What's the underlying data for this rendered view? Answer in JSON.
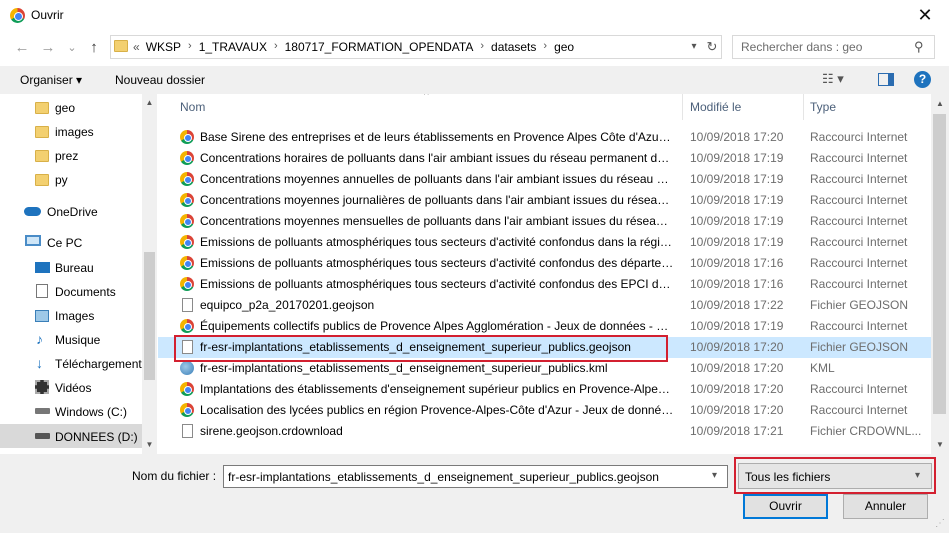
{
  "window": {
    "title": "Ouvrir",
    "close_glyph": "✕"
  },
  "nav": {
    "back_glyph": "←",
    "forward_glyph": "→",
    "recent_glyph": "⌄",
    "up_glyph": "↑",
    "breadcrumb_prefix": "«",
    "breadcrumbs": [
      "WKSP",
      "1_TRAVAUX",
      "180717_FORMATION_OPENDATA",
      "datasets",
      "geo"
    ],
    "search_placeholder": "Rechercher dans : geo"
  },
  "toolbar": {
    "organize_label": "Organiser ▾",
    "new_folder_label": "Nouveau dossier",
    "help_glyph": "?"
  },
  "sidebar": {
    "items": [
      {
        "label": "geo",
        "icon": "folder-icon"
      },
      {
        "label": "images",
        "icon": "folder-icon"
      },
      {
        "label": "prez",
        "icon": "folder-icon"
      },
      {
        "label": "py",
        "icon": "folder-icon"
      },
      {
        "label": "OneDrive",
        "icon": "onedrive-icon"
      },
      {
        "label": "Ce PC",
        "icon": "pc-icon"
      },
      {
        "label": "Bureau",
        "icon": "desktop-icon"
      },
      {
        "label": "Documents",
        "icon": "documents-icon"
      },
      {
        "label": "Images",
        "icon": "pictures-icon"
      },
      {
        "label": "Musique",
        "icon": "music-icon"
      },
      {
        "label": "Téléchargement",
        "icon": "download-icon"
      },
      {
        "label": "Vidéos",
        "icon": "videos-icon"
      },
      {
        "label": "Windows (C:)",
        "icon": "drive-icon"
      },
      {
        "label": "DONNEES (D:)",
        "icon": "drive-icon"
      }
    ]
  },
  "list": {
    "columns": {
      "name": "Nom",
      "modified": "Modifié le",
      "type": "Type"
    },
    "rows": [
      {
        "name": "Base Sirene des entreprises et de leurs établissements en Provence Alpes Côte d'Azur - Je...",
        "date": "10/09/2018 17:20",
        "type": "Raccourci Internet",
        "icon": "url"
      },
      {
        "name": "Concentrations horaires de polluants dans l'air ambiant issues du réseau permanent de ...",
        "date": "10/09/2018 17:19",
        "type": "Raccourci Internet",
        "icon": "url"
      },
      {
        "name": "Concentrations moyennes annuelles de polluants dans l'air ambiant issues du réseau per...",
        "date": "10/09/2018 17:19",
        "type": "Raccourci Internet",
        "icon": "url"
      },
      {
        "name": "Concentrations moyennes journalières de polluants dans l'air ambiant issues du réseau p...",
        "date": "10/09/2018 17:19",
        "type": "Raccourci Internet",
        "icon": "url"
      },
      {
        "name": "Concentrations moyennes mensuelles de polluants dans l'air ambiant issues du réseau p...",
        "date": "10/09/2018 17:19",
        "type": "Raccourci Internet",
        "icon": "url"
      },
      {
        "name": "Emissions de polluants atmosphériques tous secteurs d'activité confondus dans la régio...",
        "date": "10/09/2018 17:19",
        "type": "Raccourci Internet",
        "icon": "url"
      },
      {
        "name": "Emissions de polluants atmosphériques tous secteurs d'activité confondus des départem...",
        "date": "10/09/2018 17:16",
        "type": "Raccourci Internet",
        "icon": "url"
      },
      {
        "name": "Emissions de polluants atmosphériques tous secteurs d'activité confondus des EPCI de la...",
        "date": "10/09/2018 17:16",
        "type": "Raccourci Internet",
        "icon": "url"
      },
      {
        "name": "equipco_p2a_20170201.geojson",
        "date": "10/09/2018 17:22",
        "type": "Fichier GEOJSON",
        "icon": "file"
      },
      {
        "name": "Équipements collectifs publics de Provence Alpes Agglomération - Jeux de données - DA...",
        "date": "10/09/2018 17:19",
        "type": "Raccourci Internet",
        "icon": "url"
      },
      {
        "name": "fr-esr-implantations_etablissements_d_enseignement_superieur_publics.geojson",
        "date": "10/09/2018 17:20",
        "type": "Fichier GEOJSON",
        "icon": "file",
        "selected": true
      },
      {
        "name": "fr-esr-implantations_etablissements_d_enseignement_superieur_publics.kml",
        "date": "10/09/2018 17:20",
        "type": "KML",
        "icon": "kml"
      },
      {
        "name": "Implantations des établissements d'enseignement supérieur publics en Provence-Alpes-...",
        "date": "10/09/2018 17:20",
        "type": "Raccourci Internet",
        "icon": "url"
      },
      {
        "name": "Localisation des lycées publics en région Provence-Alpes-Côte d'Azur - Jeux de données ...",
        "date": "10/09/2018 17:20",
        "type": "Raccourci Internet",
        "icon": "url"
      },
      {
        "name": "sirene.geojson.crdownload",
        "date": "10/09/2018 17:21",
        "type": "Fichier CRDOWNL...",
        "icon": "file"
      }
    ]
  },
  "footer": {
    "filename_label": "Nom du fichier :",
    "filename_value": "fr-esr-implantations_etablissements_d_enseignement_superieur_publics.geojson",
    "filter_value": "Tous les fichiers",
    "open_label": "Ouvrir",
    "cancel_label": "Annuler"
  },
  "colors": {
    "highlight": "#d32030",
    "selection": "#cce8ff",
    "accent": "#0078d7"
  }
}
